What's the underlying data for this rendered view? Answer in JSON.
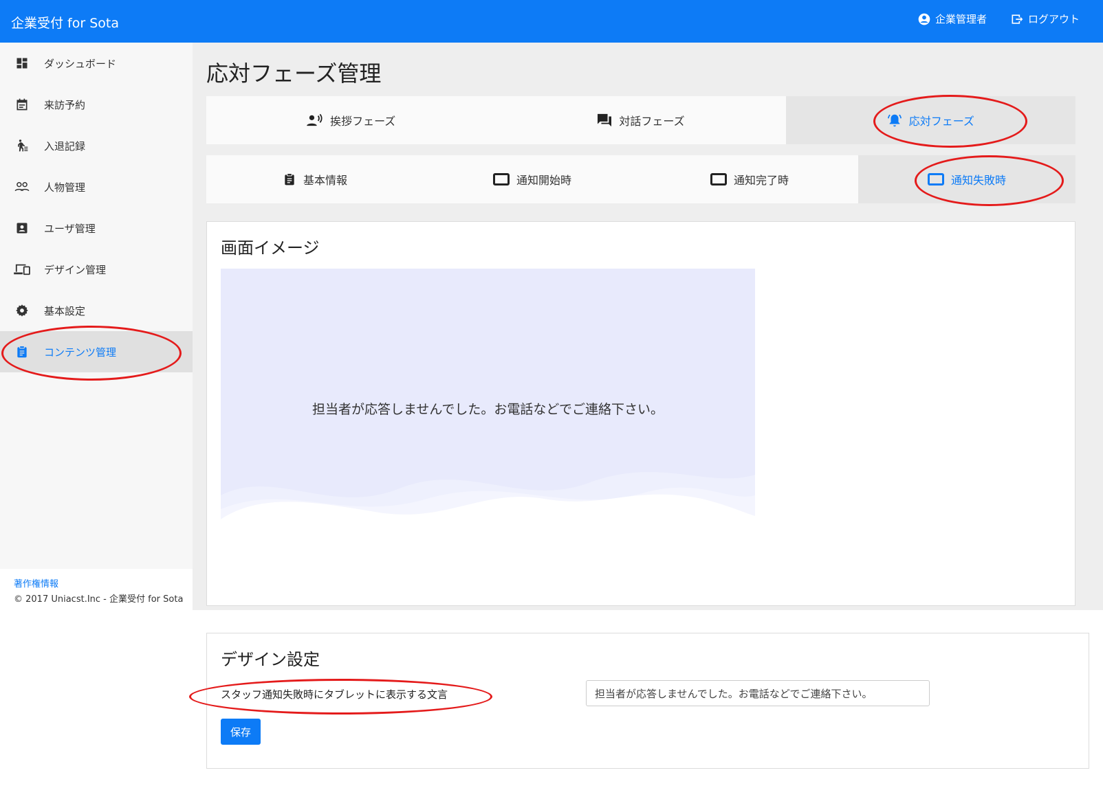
{
  "app": {
    "brand": "企業受付 for Sota",
    "user_label": "企業管理者",
    "logout_label": "ログアウト"
  },
  "sidebar": {
    "items": [
      {
        "label": "ダッシュボード",
        "icon": "dashboard-icon"
      },
      {
        "label": "来訪予約",
        "icon": "calendar-icon"
      },
      {
        "label": "入退記録",
        "icon": "walk-icon"
      },
      {
        "label": "人物管理",
        "icon": "people-icon"
      },
      {
        "label": "ユーザ管理",
        "icon": "account-box-icon"
      },
      {
        "label": "デザイン管理",
        "icon": "devices-icon"
      },
      {
        "label": "基本設定",
        "icon": "gear-icon"
      },
      {
        "label": "コンテンツ管理",
        "icon": "clipboard-icon"
      }
    ],
    "active_index": 7,
    "footer_link": "著作権情報",
    "footer_copy": "© 2017 Uniacst.Inc - 企業受付 for Sota"
  },
  "page": {
    "title": "応対フェーズ管理"
  },
  "phase_tabs": [
    {
      "label": "挨拶フェーズ",
      "icon": "voice-icon"
    },
    {
      "label": "対話フェーズ",
      "icon": "chat-icon"
    },
    {
      "label": "応対フェーズ",
      "icon": "bell-icon"
    }
  ],
  "sub_tabs": [
    {
      "label": "基本情報",
      "icon": "clipboard-icon"
    },
    {
      "label": "通知開始時",
      "icon": "tablet-icon"
    },
    {
      "label": "通知完了時",
      "icon": "tablet-icon"
    },
    {
      "label": "通知失敗時",
      "icon": "tablet-icon"
    }
  ],
  "preview": {
    "title": "画面イメージ",
    "message": "担当者が応答しませんでした。お電話などでご連絡下さい。"
  },
  "design": {
    "title": "デザイン設定",
    "field_label": "スタッフ通知失敗時にタブレットに表示する文言",
    "field_value": "担当者が応答しませんでした。お電話などでご連絡下さい。",
    "save_label": "保存"
  },
  "colors": {
    "primary": "#0d7bf6",
    "annotation": "#e41b1b",
    "preview_bg": "#e8eafc"
  }
}
